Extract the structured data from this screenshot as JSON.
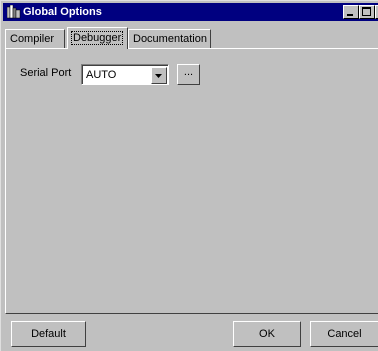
{
  "window": {
    "title": "Global Options",
    "icon": "books-app-icon",
    "controls": [
      "minimize-icon",
      "maximize-icon",
      "close-icon"
    ]
  },
  "tabs": [
    {
      "label": "Compiler",
      "active": false
    },
    {
      "label": "Debugger",
      "active": true
    },
    {
      "label": "Documentation",
      "active": false
    }
  ],
  "debugger": {
    "serial_port_label": "Serial Port",
    "serial_port_value": "AUTO",
    "browse_label": "..."
  },
  "buttons": {
    "default": "Default",
    "ok": "OK",
    "cancel": "Cancel"
  },
  "colors": {
    "face": "#c0c0c0",
    "title_bar": "#000080",
    "field": "#ffffff"
  }
}
